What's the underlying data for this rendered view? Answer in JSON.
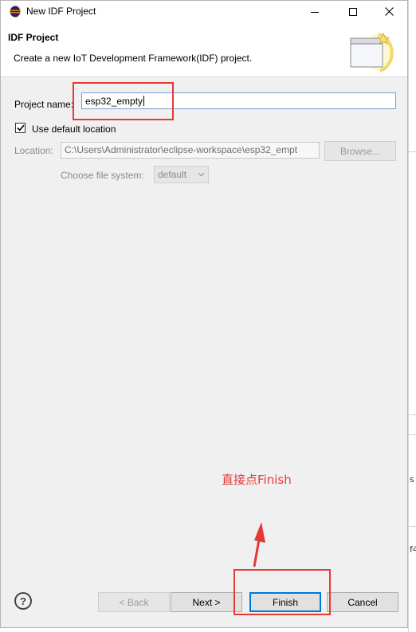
{
  "window": {
    "title": "New IDF Project"
  },
  "header": {
    "title": "IDF Project",
    "description": "Create a new IoT Development Framework(IDF) project."
  },
  "form": {
    "project_name_label": "Project name:",
    "project_name_value": "esp32_empty",
    "use_default_label": "Use default location",
    "use_default_checked": true,
    "location_label": "Location:",
    "location_value": "C:\\Users\\Administrator\\eclipse-workspace\\esp32_empt",
    "browse_label": "Browse...",
    "file_system_label": "Choose file system:",
    "file_system_value": "default"
  },
  "buttons": {
    "back": "< Back",
    "next": "Next >",
    "finish": "Finish",
    "cancel": "Cancel"
  },
  "annotation": {
    "text": "直接点Finish",
    "color": "#e53935"
  },
  "background_fragments": [
    "s",
    "f4"
  ],
  "icons": {
    "app": "eclipse-icon",
    "minimize": "minimize-icon",
    "maximize": "maximize-icon",
    "close": "close-icon",
    "wizard": "wizard-banner-icon",
    "help": "help-icon"
  }
}
